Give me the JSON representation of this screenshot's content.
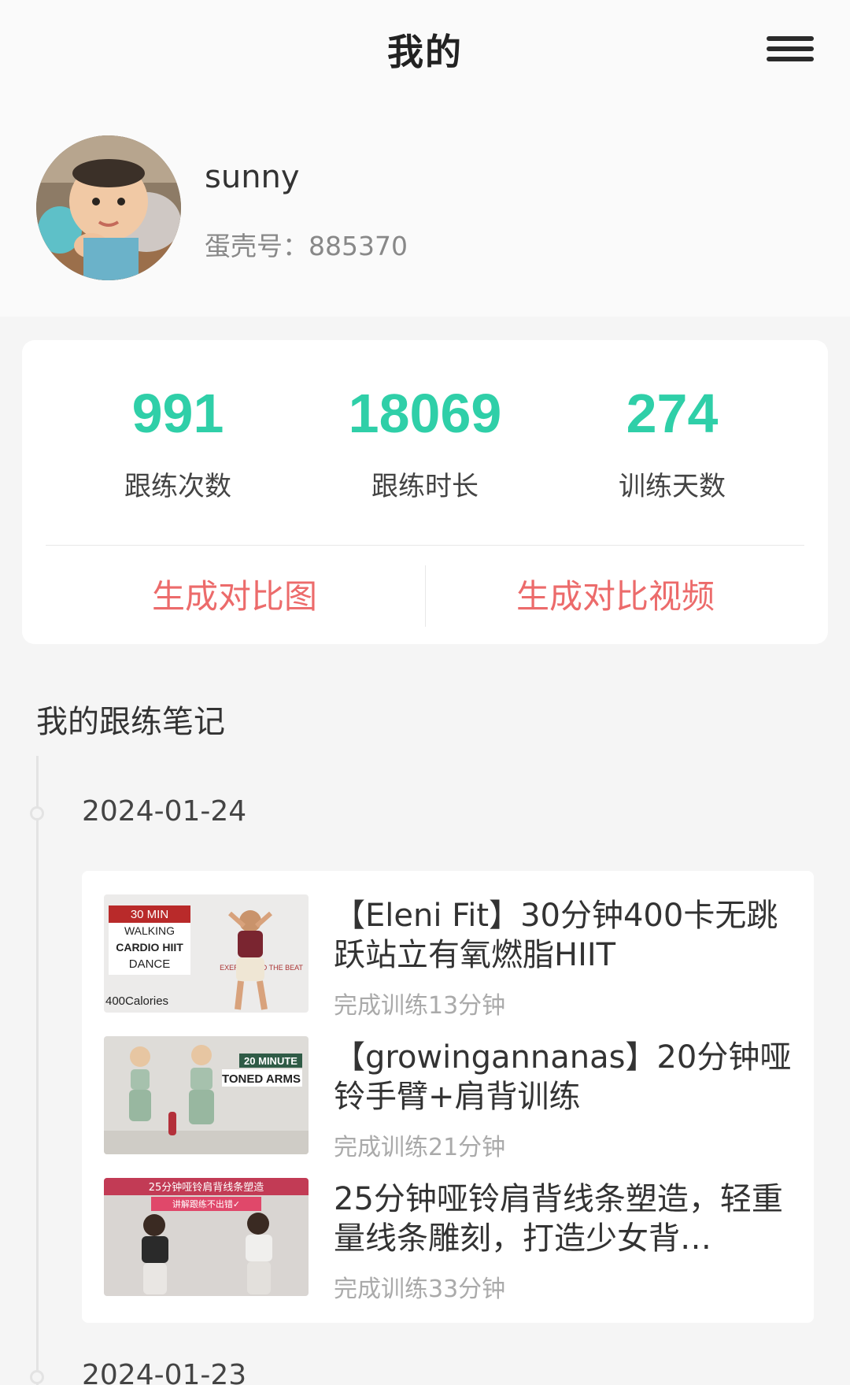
{
  "header": {
    "title": "我的"
  },
  "profile": {
    "username": "sunny",
    "egg_id": "蛋壳号：885370"
  },
  "stats": [
    {
      "value": "991",
      "label": "跟练次数"
    },
    {
      "value": "18069",
      "label": "跟练时长"
    },
    {
      "value": "274",
      "label": "训练天数"
    }
  ],
  "actions": {
    "compare_image": "生成对比图",
    "compare_video": "生成对比视频"
  },
  "notes": {
    "title": "我的跟练笔记",
    "days": [
      {
        "date": "2024-01-24",
        "workouts": [
          {
            "title": "【Eleni Fit】30分钟400卡无跳跃站立有氧燃脂HIIT",
            "subtitle": "完成训练13分钟",
            "thumb_text": [
              "30 MIN",
              "WALKING",
              "CARDIO HIIT",
              "DANCE",
              "400Calories",
              "EXERCISE TO THE BEAT"
            ]
          },
          {
            "title": "【growingannanas】20分钟哑铃手臂+肩背训练",
            "subtitle": "完成训练21分钟",
            "thumb_text": [
              "20 MINUTE",
              "TONED ARMS"
            ]
          },
          {
            "title": "25分钟哑铃肩背线条塑造，轻重量线条雕刻，打造少女背…",
            "subtitle": "完成训练33分钟",
            "thumb_text": [
              "25分钟哑铃肩背线条塑造",
              "讲解跟练不出错✓"
            ]
          }
        ]
      },
      {
        "date": "2024-01-23"
      }
    ]
  }
}
